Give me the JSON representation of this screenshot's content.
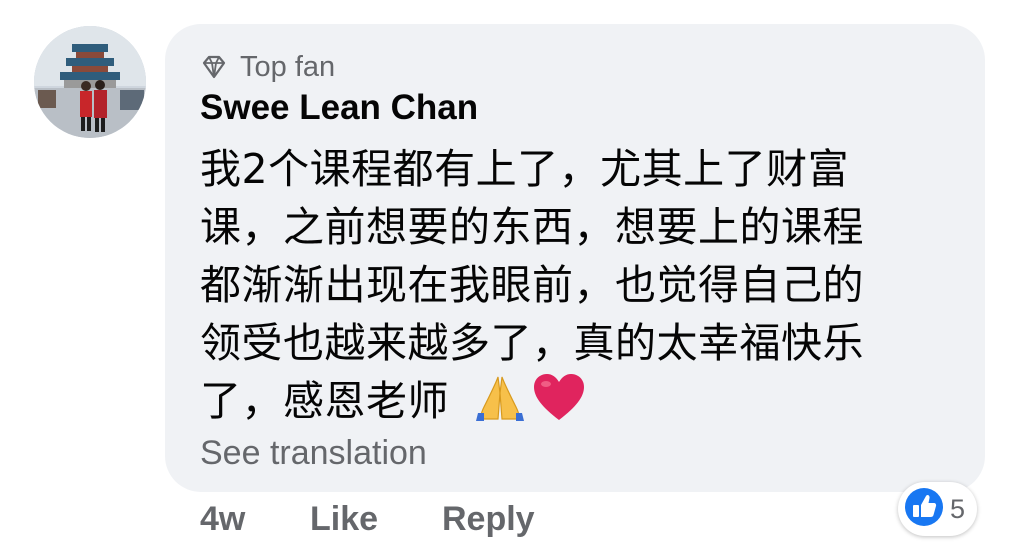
{
  "comment": {
    "badge": "Top fan",
    "author": "Swee Lean Chan",
    "lines": [
      "我2个课程都有上了，尤其上了财富",
      "课，之前想要的东西，想要上的课程",
      "都渐渐出现在我眼前，也觉得自己的",
      "领受也越来越多了，真的太幸福快乐",
      "了，感恩老师"
    ],
    "emojis": [
      "folded-hands-emoji",
      "red-heart-emoji"
    ],
    "see_translation": "See translation"
  },
  "actions": {
    "time": "4w",
    "like": "Like",
    "reply": "Reply"
  },
  "reactions": {
    "icon": "like-reaction-icon",
    "count": "5",
    "color": "#1877f2"
  },
  "colors": {
    "bubble": "#f0f2f5",
    "secondary_text": "#65676b",
    "primary_text": "#050505",
    "heart": "#e0245e"
  }
}
